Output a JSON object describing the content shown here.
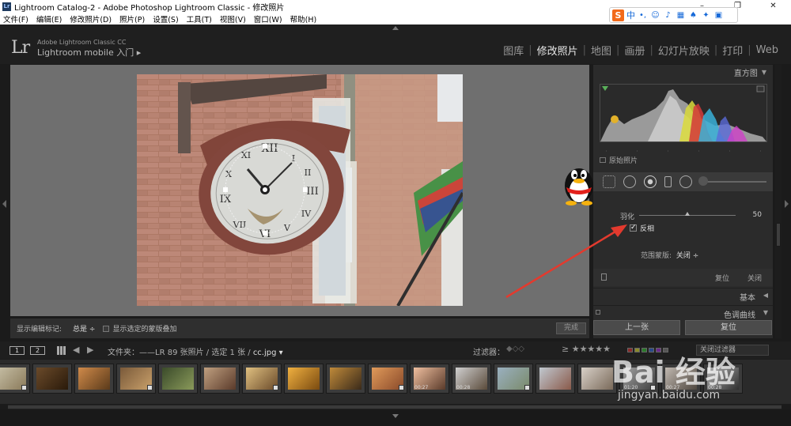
{
  "window": {
    "title": "Lightroom Catalog-2 - Adobe Photoshop Lightroom Classic - 修改照片",
    "app_icon": "Lr",
    "controls": [
      "–",
      "❐",
      "✕"
    ]
  },
  "menu": [
    "文件(F)",
    "编辑(E)",
    "修改照片(D)",
    "照片(P)",
    "设置(S)",
    "工具(T)",
    "视图(V)",
    "窗口(W)",
    "帮助(H)"
  ],
  "ime": {
    "logo": "S",
    "lang": "中"
  },
  "lr_brand": {
    "logo": "Lr",
    "sub1": "Adobe Lightroom Classic CC",
    "sub2": "Lightroom mobile 入门 ▸"
  },
  "modules": [
    "图库",
    "修改照片",
    "地图",
    "画册",
    "幻灯片放映",
    "打印",
    "Web"
  ],
  "active_module": "修改照片",
  "toolbar": {
    "show_marks_label": "显示编辑标记:",
    "show_marks_value": "总是 ÷",
    "overlay_label": "显示选定的蒙版叠加",
    "done": "完成"
  },
  "right_panel": {
    "histogram_title": "直方图",
    "original_photo": "原始照片",
    "feather_label": "羽化",
    "feather_value": "50",
    "feather_fraction": 0.5,
    "invert_label": "反相",
    "invert_checked": "✓",
    "range_mask_label": "范围蒙版:",
    "range_mask_value": "关闭 ÷",
    "reset": "复位",
    "close": "关闭",
    "basic": "基本",
    "tone_curve": "色调曲线"
  },
  "nav_buttons": {
    "prev": "上一张",
    "reset": "复位"
  },
  "filmstrip_header": {
    "page1": "1",
    "page2": "2",
    "path_prefix": "文件夹：——LR",
    "count": "89 张照片 / 选定 1 张 /",
    "filename": "cc.jpg ▾",
    "filter_label": "过滤器：",
    "stars": "≥ ★★★★★",
    "close_filter": "关闭过滤器"
  },
  "thumbnails": [
    {
      "dur": ""
    },
    {
      "dur": ""
    },
    {
      "dur": ""
    },
    {
      "dur": ""
    },
    {
      "dur": ""
    },
    {
      "dur": ""
    },
    {
      "dur": ""
    },
    {
      "dur": ""
    },
    {
      "dur": ""
    },
    {
      "dur": ""
    },
    {
      "dur": "00:27"
    },
    {
      "dur": "00:28"
    },
    {
      "dur": ""
    },
    {
      "dur": ""
    },
    {
      "dur": ""
    },
    {
      "dur": "01:20"
    },
    {
      "dur": "00:27"
    },
    {
      "dur": "00:28"
    }
  ],
  "watermark": {
    "brand": "Bai 经验",
    "url": "jingyan.baidu.com"
  }
}
